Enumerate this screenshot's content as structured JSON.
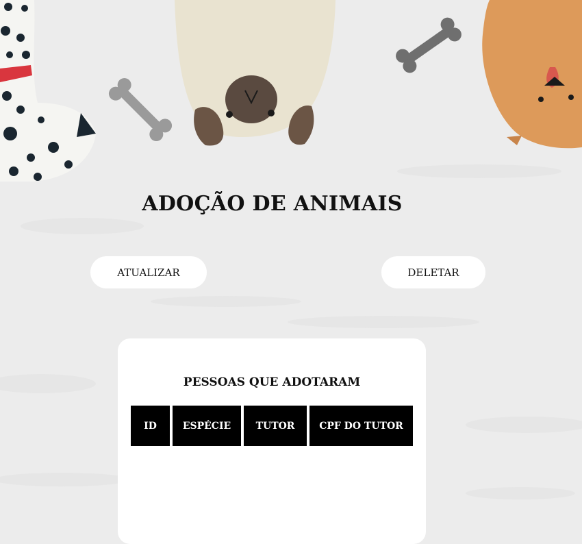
{
  "page": {
    "title": "ADOÇÃO DE ANIMAIS"
  },
  "actions": {
    "update_label": "ATUALIZAR",
    "delete_label": "DELETAR"
  },
  "adopters_table": {
    "title": "PESSOAS QUE ADOTARAM",
    "columns": [
      "ID",
      "ESPÉCIE",
      "TUTOR",
      "CPF DO TUTOR"
    ],
    "rows": []
  },
  "theme": {
    "background": "#ececec",
    "card": "#ffffff",
    "header_bg": "#000000",
    "header_text": "#ffffff"
  }
}
